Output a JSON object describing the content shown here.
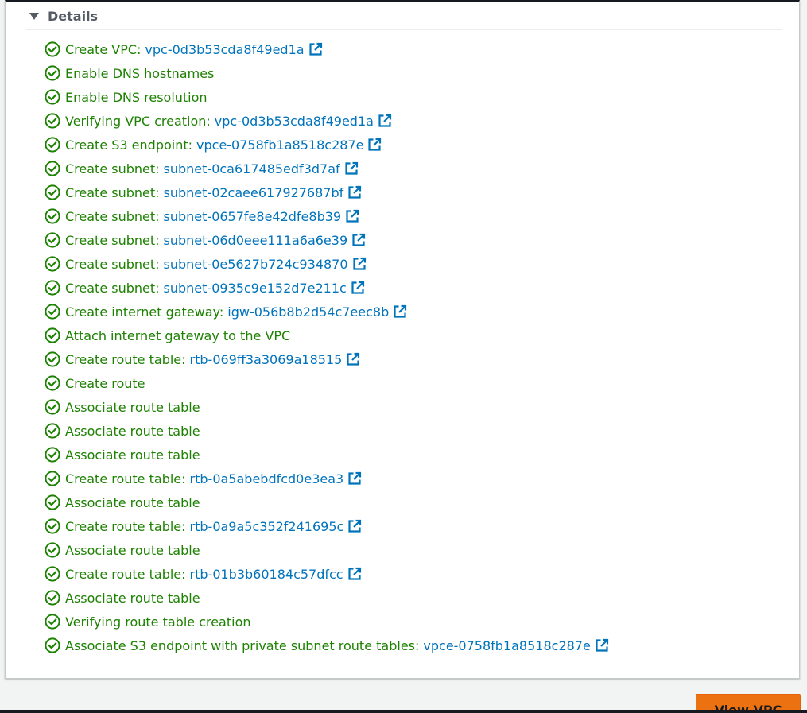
{
  "details": {
    "title": "Details",
    "steps": [
      {
        "text": "Create VPC:",
        "link": "vpc-0d3b53cda8f49ed1a"
      },
      {
        "text": "Enable DNS hostnames",
        "link": null
      },
      {
        "text": "Enable DNS resolution",
        "link": null
      },
      {
        "text": "Verifying VPC creation:",
        "link": "vpc-0d3b53cda8f49ed1a"
      },
      {
        "text": "Create S3 endpoint:",
        "link": "vpce-0758fb1a8518c287e"
      },
      {
        "text": "Create subnet:",
        "link": "subnet-0ca617485edf3d7af"
      },
      {
        "text": "Create subnet:",
        "link": "subnet-02caee617927687bf"
      },
      {
        "text": "Create subnet:",
        "link": "subnet-0657fe8e42dfe8b39"
      },
      {
        "text": "Create subnet:",
        "link": "subnet-06d0eee111a6a6e39"
      },
      {
        "text": "Create subnet:",
        "link": "subnet-0e5627b724c934870"
      },
      {
        "text": "Create subnet:",
        "link": "subnet-0935c9e152d7e211c"
      },
      {
        "text": "Create internet gateway:",
        "link": "igw-056b8b2d54c7eec8b"
      },
      {
        "text": "Attach internet gateway to the VPC",
        "link": null
      },
      {
        "text": "Create route table:",
        "link": "rtb-069ff3a3069a18515"
      },
      {
        "text": "Create route",
        "link": null
      },
      {
        "text": "Associate route table",
        "link": null
      },
      {
        "text": "Associate route table",
        "link": null
      },
      {
        "text": "Associate route table",
        "link": null
      },
      {
        "text": "Create route table:",
        "link": "rtb-0a5abebdfcd0e3ea3"
      },
      {
        "text": "Associate route table",
        "link": null
      },
      {
        "text": "Create route table:",
        "link": "rtb-0a9a5c352f241695c"
      },
      {
        "text": "Associate route table",
        "link": null
      },
      {
        "text": "Create route table:",
        "link": "rtb-01b3b60184c57dfcc"
      },
      {
        "text": "Associate route table",
        "link": null
      },
      {
        "text": "Verifying route table creation",
        "link": null
      },
      {
        "text": "Associate S3 endpoint with private subnet route tables:",
        "link": "vpce-0758fb1a8518c287e"
      }
    ]
  },
  "actions": {
    "view_vpc_label": "View VPC"
  },
  "icons": {
    "success": "check-circle-icon",
    "external_link": "external-link-icon",
    "expand": "caret-down-icon"
  },
  "colors": {
    "success_green": "#1d8102",
    "link_blue": "#0073bb",
    "primary_orange": "#ec7211",
    "header_gray": "#545b64"
  }
}
